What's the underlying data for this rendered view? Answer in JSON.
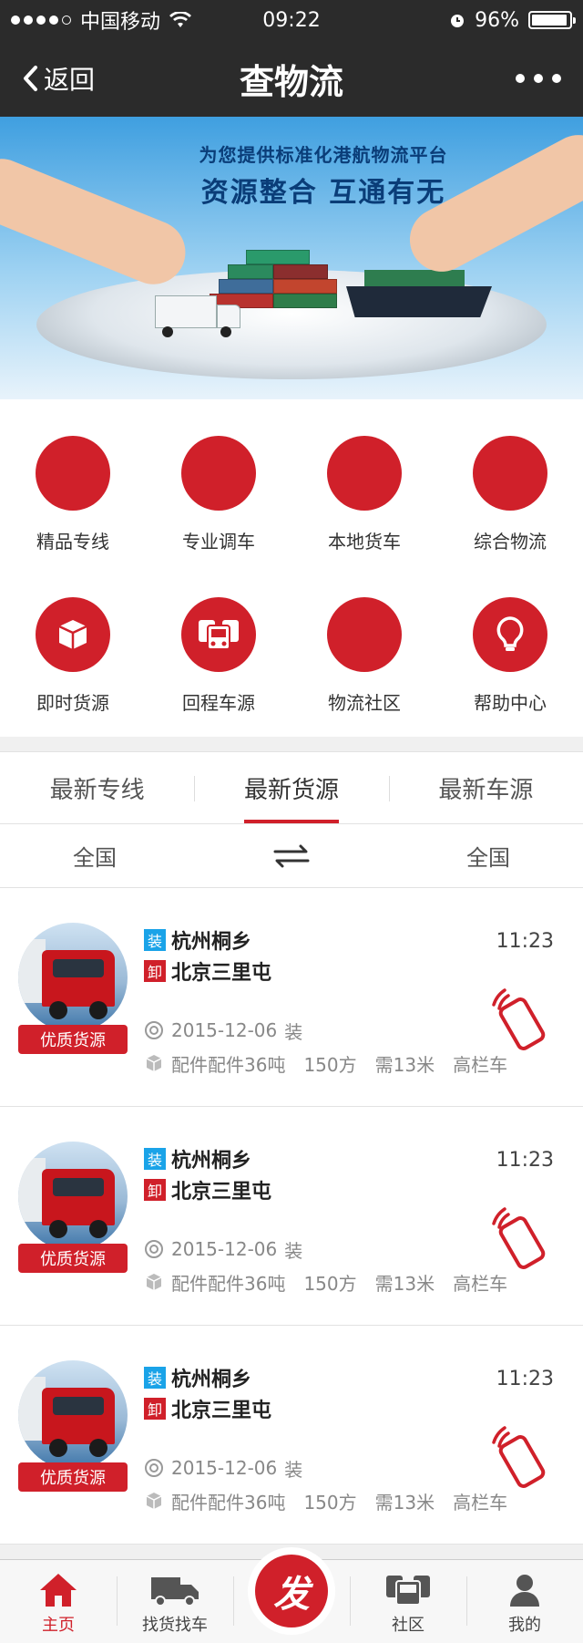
{
  "status_bar": {
    "carrier": "中国移动",
    "time": "09:22",
    "battery": "96%"
  },
  "nav": {
    "back_label": "返回",
    "title": "查物流"
  },
  "banner": {
    "line1": "为您提供标准化港航物流平台",
    "line2": "资源整合 互通有无"
  },
  "services": [
    {
      "label": "精品专线"
    },
    {
      "label": "专业调车"
    },
    {
      "label": "本地货车"
    },
    {
      "label": "综合物流"
    },
    {
      "label": "即时货源",
      "icon": "box-icon"
    },
    {
      "label": "回程车源",
      "icon": "bus-icon"
    },
    {
      "label": "物流社区"
    },
    {
      "label": "帮助中心",
      "icon": "lightbulb-icon"
    }
  ],
  "tabs": [
    {
      "label": "最新专线"
    },
    {
      "label": "最新货源",
      "active": true
    },
    {
      "label": "最新车源"
    }
  ],
  "filter": {
    "from": "全国",
    "to": "全国"
  },
  "listings": [
    {
      "badge": "优质货源",
      "load_tag": "装",
      "unload_tag": "卸",
      "origin": "杭州桐乡",
      "destination": "北京三里屯",
      "time": "11:23",
      "date": "2015-12-06",
      "date_suffix": "装",
      "cargo": "配件配件36吨",
      "volume": "150方",
      "length": "需13米",
      "truck_type": "高栏车"
    },
    {
      "badge": "优质货源",
      "load_tag": "装",
      "unload_tag": "卸",
      "origin": "杭州桐乡",
      "destination": "北京三里屯",
      "time": "11:23",
      "date": "2015-12-06",
      "date_suffix": "装",
      "cargo": "配件配件36吨",
      "volume": "150方",
      "length": "需13米",
      "truck_type": "高栏车"
    },
    {
      "badge": "优质货源",
      "load_tag": "装",
      "unload_tag": "卸",
      "origin": "杭州桐乡",
      "destination": "北京三里屯",
      "time": "11:23",
      "date": "2015-12-06",
      "date_suffix": "装",
      "cargo": "配件配件36吨",
      "volume": "150方",
      "length": "需13米",
      "truck_type": "高栏车"
    }
  ],
  "tabbar": [
    {
      "label": "主页",
      "active": true
    },
    {
      "label": "找货找车"
    },
    {
      "label": "发"
    },
    {
      "label": "社区"
    },
    {
      "label": "我的"
    }
  ],
  "colors": {
    "accent": "#d0202a",
    "nav_bg": "#2b2b2b",
    "load_tag": "#1aa3e8"
  }
}
